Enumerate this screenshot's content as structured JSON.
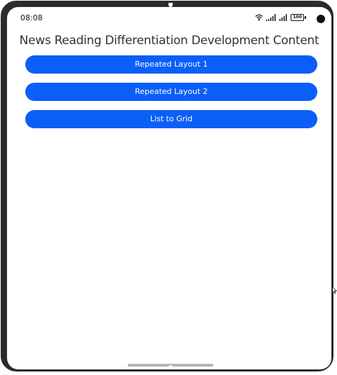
{
  "status_bar": {
    "time": "08:08",
    "battery": "100",
    "icons": [
      "wifi-icon",
      "signal-icon",
      "signal-icon",
      "battery-icon",
      "camera-icon"
    ]
  },
  "page": {
    "title": "News Reading Differentiation Development Content"
  },
  "buttons": [
    {
      "label": "Repeated Layout 1"
    },
    {
      "label": "Repeated Layout 2"
    },
    {
      "label": "List to Grid"
    }
  ],
  "colors": {
    "accent": "#0a5ff8",
    "frame": "#2b2b2b",
    "title": "#333333",
    "home_indicator": "#b3b3b3"
  }
}
